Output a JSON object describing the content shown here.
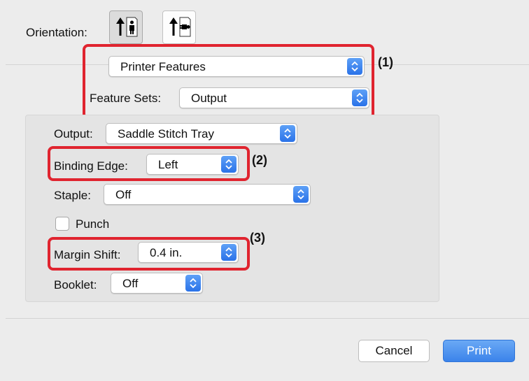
{
  "orientation": {
    "label": "Orientation:",
    "options": [
      {
        "name": "portrait",
        "selected": true
      },
      {
        "name": "landscape",
        "selected": false
      }
    ]
  },
  "feature_panel": {
    "panel_select": "Printer Features",
    "feature_sets_label": "Feature Sets:",
    "feature_sets_value": "Output"
  },
  "settings": {
    "output_label": "Output:",
    "output_value": "Saddle Stitch Tray",
    "binding_edge_label": "Binding Edge:",
    "binding_edge_value": "Left",
    "staple_label": "Staple:",
    "staple_value": "Off",
    "punch_label": "Punch",
    "punch_checked": false,
    "margin_shift_label": "Margin Shift:",
    "margin_shift_value": "0.4 in.",
    "booklet_label": "Booklet:",
    "booklet_value": "Off"
  },
  "callouts": [
    "(1)",
    "(2)",
    "(3)"
  ],
  "buttons": {
    "cancel": "Cancel",
    "print": "Print"
  },
  "colors": {
    "highlight": "#e0242f",
    "accent": "#2a72e8"
  }
}
